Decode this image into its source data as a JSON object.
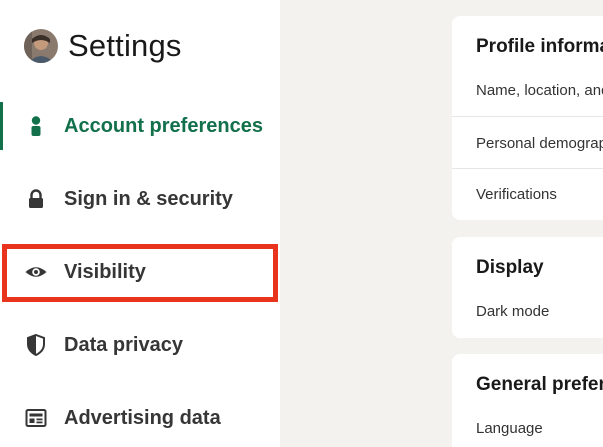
{
  "sidebar": {
    "title": "Settings",
    "items": [
      {
        "label": "Account preferences",
        "icon": "person-icon",
        "active": true
      },
      {
        "label": "Sign in & security",
        "icon": "lock-icon",
        "active": false
      },
      {
        "label": "Visibility",
        "icon": "eye-icon",
        "active": false
      },
      {
        "label": "Data privacy",
        "icon": "shield-icon",
        "active": false
      },
      {
        "label": "Advertising data",
        "icon": "newspaper-icon",
        "active": false
      }
    ]
  },
  "cards": {
    "profile": {
      "title": "Profile information",
      "rows": [
        "Name, location, and industry",
        "Personal demographic information",
        "Verifications"
      ]
    },
    "display": {
      "title": "Display",
      "rows": [
        "Dark mode"
      ]
    },
    "general": {
      "title": "General preferences",
      "rows": [
        "Language"
      ]
    }
  },
  "colors": {
    "accent": "#12704b",
    "highlight": "#e8341c",
    "background": "#f4f2ee"
  }
}
